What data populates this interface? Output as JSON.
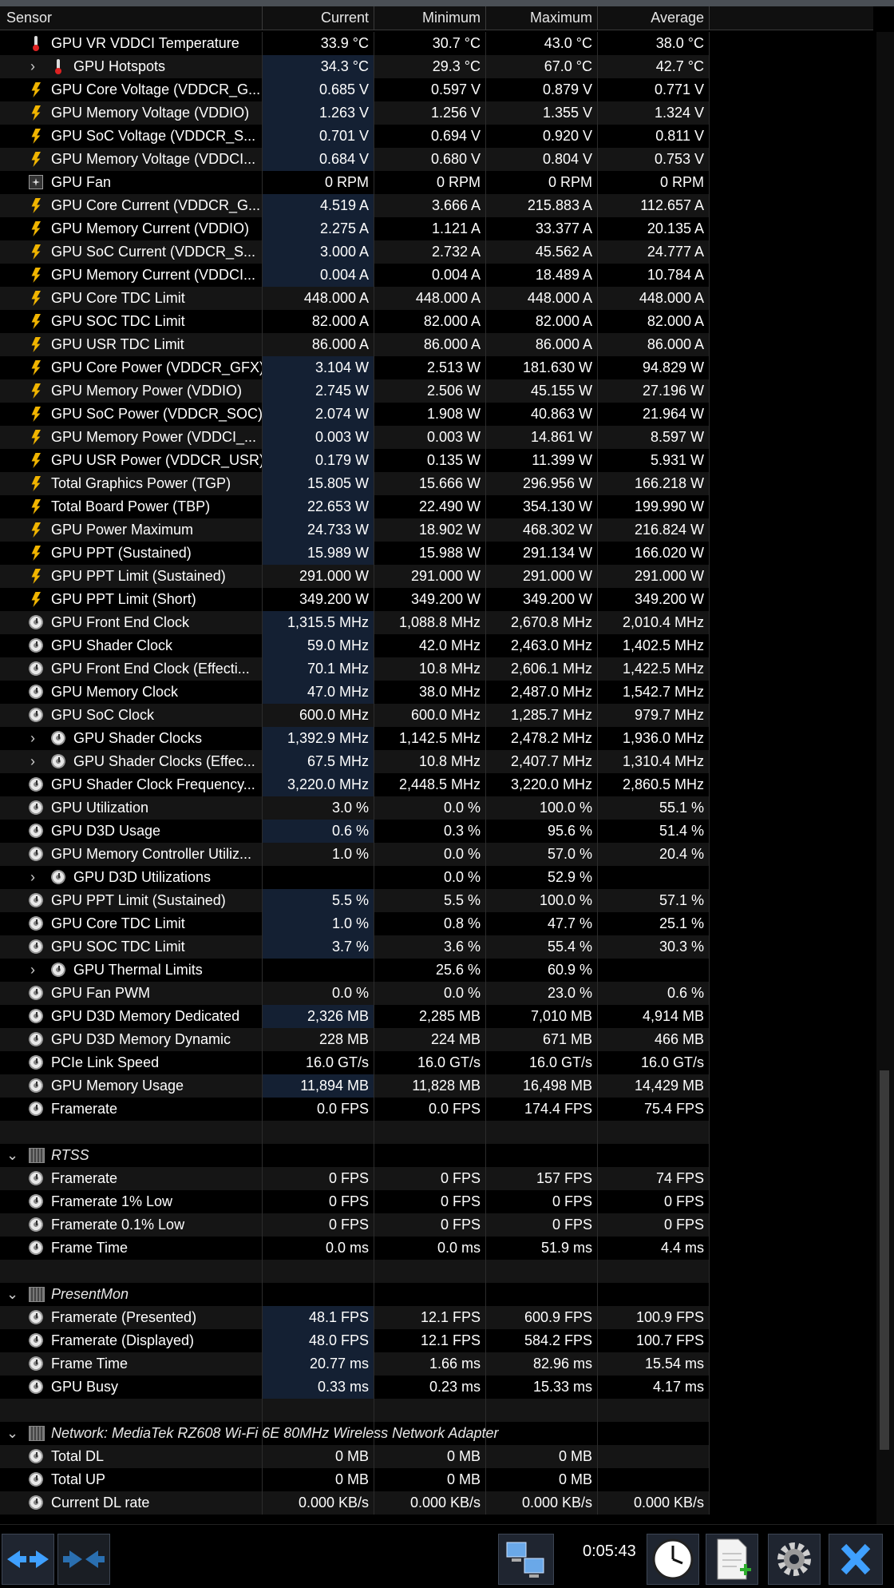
{
  "header": {
    "sensor": "Sensor",
    "current": "Current",
    "minimum": "Minimum",
    "maximum": "Maximum",
    "average": "Average"
  },
  "rows": [
    {
      "type": "sensor",
      "icon": "therm",
      "indent": 1,
      "name": "GPU VR VDDCI Temperature",
      "cur": "33.9 °C",
      "min": "30.7 °C",
      "max": "43.0 °C",
      "avg": "38.0 °C",
      "hl": false
    },
    {
      "type": "sensor",
      "icon": "therm",
      "indent": 2,
      "expand": true,
      "name": "GPU Hotspots",
      "cur": "34.3 °C",
      "min": "29.3 °C",
      "max": "67.0 °C",
      "avg": "42.7 °C",
      "hl": true
    },
    {
      "type": "sensor",
      "icon": "bolt",
      "indent": 1,
      "name": "GPU Core Voltage (VDDCR_G...",
      "cur": "0.685 V",
      "min": "0.597 V",
      "max": "0.879 V",
      "avg": "0.771 V",
      "hl": true
    },
    {
      "type": "sensor",
      "icon": "bolt",
      "indent": 1,
      "name": "GPU Memory Voltage (VDDIO)",
      "cur": "1.263 V",
      "min": "1.256 V",
      "max": "1.355 V",
      "avg": "1.324 V",
      "hl": true
    },
    {
      "type": "sensor",
      "icon": "bolt",
      "indent": 1,
      "name": "GPU SoC Voltage (VDDCR_S...",
      "cur": "0.701 V",
      "min": "0.694 V",
      "max": "0.920 V",
      "avg": "0.811 V",
      "hl": true
    },
    {
      "type": "sensor",
      "icon": "bolt",
      "indent": 1,
      "name": "GPU Memory Voltage (VDDCI...",
      "cur": "0.684 V",
      "min": "0.680 V",
      "max": "0.804 V",
      "avg": "0.753 V",
      "hl": true
    },
    {
      "type": "sensor",
      "icon": "fan",
      "indent": 1,
      "name": "GPU Fan",
      "cur": "0 RPM",
      "min": "0 RPM",
      "max": "0 RPM",
      "avg": "0 RPM",
      "hl": false
    },
    {
      "type": "sensor",
      "icon": "bolt",
      "indent": 1,
      "name": "GPU Core Current (VDDCR_G...",
      "cur": "4.519 A",
      "min": "3.666 A",
      "max": "215.883 A",
      "avg": "112.657 A",
      "hl": true
    },
    {
      "type": "sensor",
      "icon": "bolt",
      "indent": 1,
      "name": "GPU Memory Current (VDDIO)",
      "cur": "2.275 A",
      "min": "1.121 A",
      "max": "33.377 A",
      "avg": "20.135 A",
      "hl": true
    },
    {
      "type": "sensor",
      "icon": "bolt",
      "indent": 1,
      "name": "GPU SoC Current (VDDCR_S...",
      "cur": "3.000 A",
      "min": "2.732 A",
      "max": "45.562 A",
      "avg": "24.777 A",
      "hl": true
    },
    {
      "type": "sensor",
      "icon": "bolt",
      "indent": 1,
      "name": "GPU Memory Current (VDDCI...",
      "cur": "0.004 A",
      "min": "0.004 A",
      "max": "18.489 A",
      "avg": "10.784 A",
      "hl": true
    },
    {
      "type": "sensor",
      "icon": "bolt",
      "indent": 1,
      "name": "GPU Core TDC Limit",
      "cur": "448.000 A",
      "min": "448.000 A",
      "max": "448.000 A",
      "avg": "448.000 A",
      "hl": false
    },
    {
      "type": "sensor",
      "icon": "bolt",
      "indent": 1,
      "name": "GPU SOC TDC Limit",
      "cur": "82.000 A",
      "min": "82.000 A",
      "max": "82.000 A",
      "avg": "82.000 A",
      "hl": false
    },
    {
      "type": "sensor",
      "icon": "bolt",
      "indent": 1,
      "name": "GPU USR TDC Limit",
      "cur": "86.000 A",
      "min": "86.000 A",
      "max": "86.000 A",
      "avg": "86.000 A",
      "hl": false
    },
    {
      "type": "sensor",
      "icon": "bolt",
      "indent": 1,
      "name": "GPU Core Power (VDDCR_GFX)",
      "cur": "3.104 W",
      "min": "2.513 W",
      "max": "181.630 W",
      "avg": "94.829 W",
      "hl": true
    },
    {
      "type": "sensor",
      "icon": "bolt",
      "indent": 1,
      "name": "GPU Memory Power (VDDIO)",
      "cur": "2.745 W",
      "min": "2.506 W",
      "max": "45.155 W",
      "avg": "27.196 W",
      "hl": true
    },
    {
      "type": "sensor",
      "icon": "bolt",
      "indent": 1,
      "name": "GPU SoC Power (VDDCR_SOC)",
      "cur": "2.074 W",
      "min": "1.908 W",
      "max": "40.863 W",
      "avg": "21.964 W",
      "hl": true
    },
    {
      "type": "sensor",
      "icon": "bolt",
      "indent": 1,
      "name": "GPU Memory Power (VDDCI_...",
      "cur": "0.003 W",
      "min": "0.003 W",
      "max": "14.861 W",
      "avg": "8.597 W",
      "hl": true
    },
    {
      "type": "sensor",
      "icon": "bolt",
      "indent": 1,
      "name": "GPU USR Power (VDDCR_USR)",
      "cur": "0.179 W",
      "min": "0.135 W",
      "max": "11.399 W",
      "avg": "5.931 W",
      "hl": true
    },
    {
      "type": "sensor",
      "icon": "bolt",
      "indent": 1,
      "name": "Total Graphics Power (TGP)",
      "cur": "15.805 W",
      "min": "15.666 W",
      "max": "296.956 W",
      "avg": "166.218 W",
      "hl": true
    },
    {
      "type": "sensor",
      "icon": "bolt",
      "indent": 1,
      "name": "Total Board Power (TBP)",
      "cur": "22.653 W",
      "min": "22.490 W",
      "max": "354.130 W",
      "avg": "199.990 W",
      "hl": true
    },
    {
      "type": "sensor",
      "icon": "bolt",
      "indent": 1,
      "name": "GPU Power Maximum",
      "cur": "24.733 W",
      "min": "18.902 W",
      "max": "468.302 W",
      "avg": "216.824 W",
      "hl": true
    },
    {
      "type": "sensor",
      "icon": "bolt",
      "indent": 1,
      "name": "GPU PPT (Sustained)",
      "cur": "15.989 W",
      "min": "15.988 W",
      "max": "291.134 W",
      "avg": "166.020 W",
      "hl": true
    },
    {
      "type": "sensor",
      "icon": "bolt",
      "indent": 1,
      "name": "GPU PPT Limit (Sustained)",
      "cur": "291.000 W",
      "min": "291.000 W",
      "max": "291.000 W",
      "avg": "291.000 W",
      "hl": false
    },
    {
      "type": "sensor",
      "icon": "bolt",
      "indent": 1,
      "name": "GPU PPT Limit (Short)",
      "cur": "349.200 W",
      "min": "349.200 W",
      "max": "349.200 W",
      "avg": "349.200 W",
      "hl": false
    },
    {
      "type": "sensor",
      "icon": "clock",
      "indent": 1,
      "name": "GPU Front End Clock",
      "cur": "1,315.5 MHz",
      "min": "1,088.8 MHz",
      "max": "2,670.8 MHz",
      "avg": "2,010.4 MHz",
      "hl": true
    },
    {
      "type": "sensor",
      "icon": "clock",
      "indent": 1,
      "name": "GPU Shader Clock",
      "cur": "59.0 MHz",
      "min": "42.0 MHz",
      "max": "2,463.0 MHz",
      "avg": "1,402.5 MHz",
      "hl": true
    },
    {
      "type": "sensor",
      "icon": "clock",
      "indent": 1,
      "name": "GPU Front End Clock (Effecti...",
      "cur": "70.1 MHz",
      "min": "10.8 MHz",
      "max": "2,606.1 MHz",
      "avg": "1,422.5 MHz",
      "hl": true
    },
    {
      "type": "sensor",
      "icon": "clock",
      "indent": 1,
      "name": "GPU Memory Clock",
      "cur": "47.0 MHz",
      "min": "38.0 MHz",
      "max": "2,487.0 MHz",
      "avg": "1,542.7 MHz",
      "hl": true
    },
    {
      "type": "sensor",
      "icon": "clock",
      "indent": 1,
      "name": "GPU SoC Clock",
      "cur": "600.0 MHz",
      "min": "600.0 MHz",
      "max": "1,285.7 MHz",
      "avg": "979.7 MHz",
      "hl": false
    },
    {
      "type": "sensor",
      "icon": "clock",
      "indent": 2,
      "expand": true,
      "name": "GPU Shader Clocks",
      "cur": "1,392.9 MHz",
      "min": "1,142.5 MHz",
      "max": "2,478.2 MHz",
      "avg": "1,936.0 MHz",
      "hl": true
    },
    {
      "type": "sensor",
      "icon": "clock",
      "indent": 2,
      "expand": true,
      "name": "GPU Shader Clocks (Effec...",
      "cur": "67.5 MHz",
      "min": "10.8 MHz",
      "max": "2,407.7 MHz",
      "avg": "1,310.4 MHz",
      "hl": true
    },
    {
      "type": "sensor",
      "icon": "clock",
      "indent": 1,
      "name": "GPU Shader Clock Frequency...",
      "cur": "3,220.0 MHz",
      "min": "2,448.5 MHz",
      "max": "3,220.0 MHz",
      "avg": "2,860.5 MHz",
      "hl": true
    },
    {
      "type": "sensor",
      "icon": "clock",
      "indent": 1,
      "name": "GPU Utilization",
      "cur": "3.0 %",
      "min": "0.0 %",
      "max": "100.0 %",
      "avg": "55.1 %",
      "hl": false
    },
    {
      "type": "sensor",
      "icon": "clock",
      "indent": 1,
      "name": "GPU D3D Usage",
      "cur": "0.6 %",
      "min": "0.3 %",
      "max": "95.6 %",
      "avg": "51.4 %",
      "hl": true
    },
    {
      "type": "sensor",
      "icon": "clock",
      "indent": 1,
      "name": "GPU Memory Controller Utiliz...",
      "cur": "1.0 %",
      "min": "0.0 %",
      "max": "57.0 %",
      "avg": "20.4 %",
      "hl": false
    },
    {
      "type": "sensor",
      "icon": "clock",
      "indent": 2,
      "expand": true,
      "name": "GPU D3D Utilizations",
      "cur": "",
      "min": "0.0 %",
      "max": "52.9 %",
      "avg": "",
      "hl": false
    },
    {
      "type": "sensor",
      "icon": "clock",
      "indent": 1,
      "name": "GPU PPT Limit (Sustained)",
      "cur": "5.5 %",
      "min": "5.5 %",
      "max": "100.0 %",
      "avg": "57.1 %",
      "hl": true
    },
    {
      "type": "sensor",
      "icon": "clock",
      "indent": 1,
      "name": "GPU Core TDC Limit",
      "cur": "1.0 %",
      "min": "0.8 %",
      "max": "47.7 %",
      "avg": "25.1 %",
      "hl": true
    },
    {
      "type": "sensor",
      "icon": "clock",
      "indent": 1,
      "name": "GPU SOC TDC Limit",
      "cur": "3.7 %",
      "min": "3.6 %",
      "max": "55.4 %",
      "avg": "30.3 %",
      "hl": true
    },
    {
      "type": "sensor",
      "icon": "clock",
      "indent": 2,
      "expand": true,
      "name": "GPU Thermal Limits",
      "cur": "",
      "min": "25.6 %",
      "max": "60.9 %",
      "avg": "",
      "hl": false
    },
    {
      "type": "sensor",
      "icon": "clock",
      "indent": 1,
      "name": "GPU Fan PWM",
      "cur": "0.0 %",
      "min": "0.0 %",
      "max": "23.0 %",
      "avg": "0.6 %",
      "hl": false
    },
    {
      "type": "sensor",
      "icon": "clock",
      "indent": 1,
      "name": "GPU D3D Memory Dedicated",
      "cur": "2,326 MB",
      "min": "2,285 MB",
      "max": "7,010 MB",
      "avg": "4,914 MB",
      "hl": true
    },
    {
      "type": "sensor",
      "icon": "clock",
      "indent": 1,
      "name": "GPU D3D Memory Dynamic",
      "cur": "228 MB",
      "min": "224 MB",
      "max": "671 MB",
      "avg": "466 MB",
      "hl": false
    },
    {
      "type": "sensor",
      "icon": "clock",
      "indent": 1,
      "name": "PCIe Link Speed",
      "cur": "16.0 GT/s",
      "min": "16.0 GT/s",
      "max": "16.0 GT/s",
      "avg": "16.0 GT/s",
      "hl": false
    },
    {
      "type": "sensor",
      "icon": "clock",
      "indent": 1,
      "name": "GPU Memory Usage",
      "cur": "11,894 MB",
      "min": "11,828 MB",
      "max": "16,498 MB",
      "avg": "14,429 MB",
      "hl": true
    },
    {
      "type": "sensor",
      "icon": "clock",
      "indent": 1,
      "name": "Framerate",
      "cur": "0.0 FPS",
      "min": "0.0 FPS",
      "max": "174.4 FPS",
      "avg": "75.4 FPS",
      "hl": false
    },
    {
      "type": "blank"
    },
    {
      "type": "group",
      "name": "RTSS"
    },
    {
      "type": "sensor",
      "icon": "clock",
      "indent": 1,
      "name": "Framerate",
      "cur": "0 FPS",
      "min": "0 FPS",
      "max": "157 FPS",
      "avg": "74 FPS",
      "hl": false
    },
    {
      "type": "sensor",
      "icon": "clock",
      "indent": 1,
      "name": "Framerate 1% Low",
      "cur": "0 FPS",
      "min": "0 FPS",
      "max": "0 FPS",
      "avg": "0 FPS",
      "hl": false
    },
    {
      "type": "sensor",
      "icon": "clock",
      "indent": 1,
      "name": "Framerate 0.1% Low",
      "cur": "0 FPS",
      "min": "0 FPS",
      "max": "0 FPS",
      "avg": "0 FPS",
      "hl": false
    },
    {
      "type": "sensor",
      "icon": "clock",
      "indent": 1,
      "name": "Frame Time",
      "cur": "0.0 ms",
      "min": "0.0 ms",
      "max": "51.9 ms",
      "avg": "4.4 ms",
      "hl": false
    },
    {
      "type": "blank"
    },
    {
      "type": "group",
      "name": "PresentMon"
    },
    {
      "type": "sensor",
      "icon": "clock",
      "indent": 1,
      "name": "Framerate (Presented)",
      "cur": "48.1 FPS",
      "min": "12.1 FPS",
      "max": "600.9 FPS",
      "avg": "100.9 FPS",
      "hl": true
    },
    {
      "type": "sensor",
      "icon": "clock",
      "indent": 1,
      "name": "Framerate (Displayed)",
      "cur": "48.0 FPS",
      "min": "12.1 FPS",
      "max": "584.2 FPS",
      "avg": "100.7 FPS",
      "hl": true
    },
    {
      "type": "sensor",
      "icon": "clock",
      "indent": 1,
      "name": "Frame Time",
      "cur": "20.77 ms",
      "min": "1.66 ms",
      "max": "82.96 ms",
      "avg": "15.54 ms",
      "hl": true
    },
    {
      "type": "sensor",
      "icon": "clock",
      "indent": 1,
      "name": "GPU Busy",
      "cur": "0.33 ms",
      "min": "0.23 ms",
      "max": "15.33 ms",
      "avg": "4.17 ms",
      "hl": true
    },
    {
      "type": "blank"
    },
    {
      "type": "group",
      "name": "Network: MediaTek RZ608 Wi-Fi 6E 80MHz Wireless Network Adapter"
    },
    {
      "type": "sensor",
      "icon": "clock",
      "indent": 1,
      "name": "Total DL",
      "cur": "0 MB",
      "min": "0 MB",
      "max": "0 MB",
      "avg": "",
      "hl": false
    },
    {
      "type": "sensor",
      "icon": "clock",
      "indent": 1,
      "name": "Total UP",
      "cur": "0 MB",
      "min": "0 MB",
      "max": "0 MB",
      "avg": "",
      "hl": false
    },
    {
      "type": "sensor",
      "icon": "clock",
      "indent": 1,
      "name": "Current DL rate",
      "cur": "0.000 KB/s",
      "min": "0.000 KB/s",
      "max": "0.000 KB/s",
      "avg": "0.000 KB/s",
      "hl": false
    }
  ],
  "footer": {
    "timer": "0:05:43",
    "buttons": [
      "navigate-arrows-icon",
      "collapse-arrows-icon",
      "network-computers-icon",
      "clock-icon",
      "new-report-icon",
      "settings-gear-icon",
      "close-x-icon"
    ]
  },
  "colors": {
    "highlight": "#142033",
    "row_alt": "#151515",
    "accent_blue": "#3fa0ff"
  }
}
